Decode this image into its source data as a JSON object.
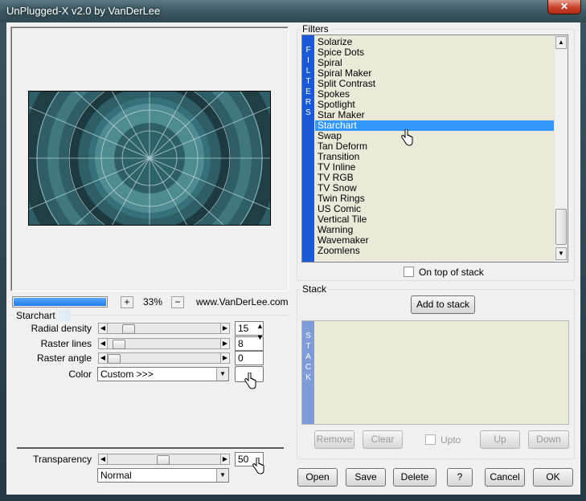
{
  "window": {
    "title": "UnPlugged-X v2.0 by VanDerLee",
    "close_glyph": "✕"
  },
  "preview": {
    "progress": 1.0,
    "zoom": "33%",
    "zoom_in": "+",
    "zoom_out": "−",
    "link": "www.VanDerLee.com"
  },
  "filters": {
    "group_label": "Filters",
    "strip_letters": [
      "F",
      "I",
      "L",
      "T",
      "E",
      "R",
      "S"
    ],
    "items": [
      "Solarize",
      "Spice Dots",
      "Spiral",
      "Spiral Maker",
      "Split Contrast",
      "Spokes",
      "Spotlight",
      "Star Maker",
      "Starchart",
      "Swap",
      "Tan Deform",
      "Transition",
      "TV Inline",
      "TV RGB",
      "TV Snow",
      "Twin Rings",
      "US Comic",
      "Vertical Tile",
      "Warning",
      "Wavemaker",
      "Zoomlens"
    ],
    "selected": "Starchart",
    "on_top_label": "On top of stack",
    "scroll_up": "▲",
    "scroll_down": "▼"
  },
  "starchart": {
    "group_label": "Starchart",
    "params": [
      {
        "label": "Radial density",
        "value": "15"
      },
      {
        "label": "Raster lines",
        "value": "8"
      },
      {
        "label": "Raster angle",
        "value": "0"
      }
    ],
    "color_label": "Color",
    "color_value": "Custom >>>"
  },
  "transparency": {
    "label": "Transparency",
    "value": "50",
    "blend_mode": "Normal"
  },
  "stack": {
    "group_label": "Stack",
    "add_label": "Add to stack",
    "strip_letters": [
      "S",
      "T",
      "A",
      "C",
      "K"
    ],
    "remove_label": "Remove",
    "clear_label": "Clear",
    "upto_label": "Upto",
    "up_label": "Up",
    "down_label": "Down"
  },
  "footer": {
    "open": "Open",
    "save": "Save",
    "delete": "Delete",
    "help": "?",
    "cancel": "Cancel",
    "ok": "OK"
  },
  "colors": {
    "list_bg": "#ebe9d8",
    "selection": "#3399ff",
    "strip_blue": "#1a5ad8",
    "preview_teal": "#3b6c75"
  }
}
